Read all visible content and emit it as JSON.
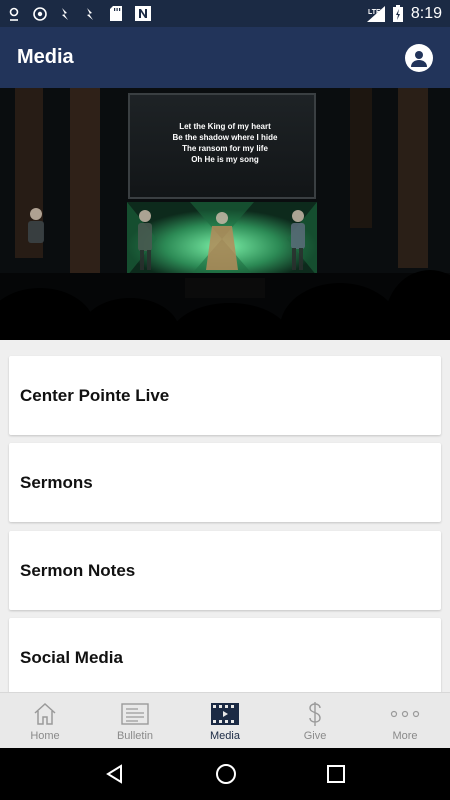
{
  "status_bar": {
    "icons": [
      "location-icon",
      "sports-icon",
      "notification-icon",
      "notification-icon-2",
      "sd-card-icon",
      "n-icon"
    ],
    "network": "LTE",
    "time": "8:19"
  },
  "app_bar": {
    "title": "Media",
    "profile_icon": "profile-icon"
  },
  "hero": {
    "lyrics": [
      "Let the King of my heart",
      "Be the shadow where I hide",
      "The ransom for my life",
      "Oh He is my song"
    ]
  },
  "media_list": [
    {
      "label": "Center Pointe Live"
    },
    {
      "label": "Sermons"
    },
    {
      "label": "Sermon Notes"
    },
    {
      "label": "Social Media"
    }
  ],
  "tabs": [
    {
      "label": "Home",
      "icon": "home-icon",
      "active": false
    },
    {
      "label": "Bulletin",
      "icon": "bulletin-icon",
      "active": false
    },
    {
      "label": "Media",
      "icon": "media-icon",
      "active": true
    },
    {
      "label": "Give",
      "icon": "dollar-icon",
      "active": false
    },
    {
      "label": "More",
      "icon": "more-icon",
      "active": false
    }
  ],
  "colors": {
    "header": "#22345a",
    "status_bar": "#1b2a44",
    "active_tab": "#1b2a44"
  }
}
